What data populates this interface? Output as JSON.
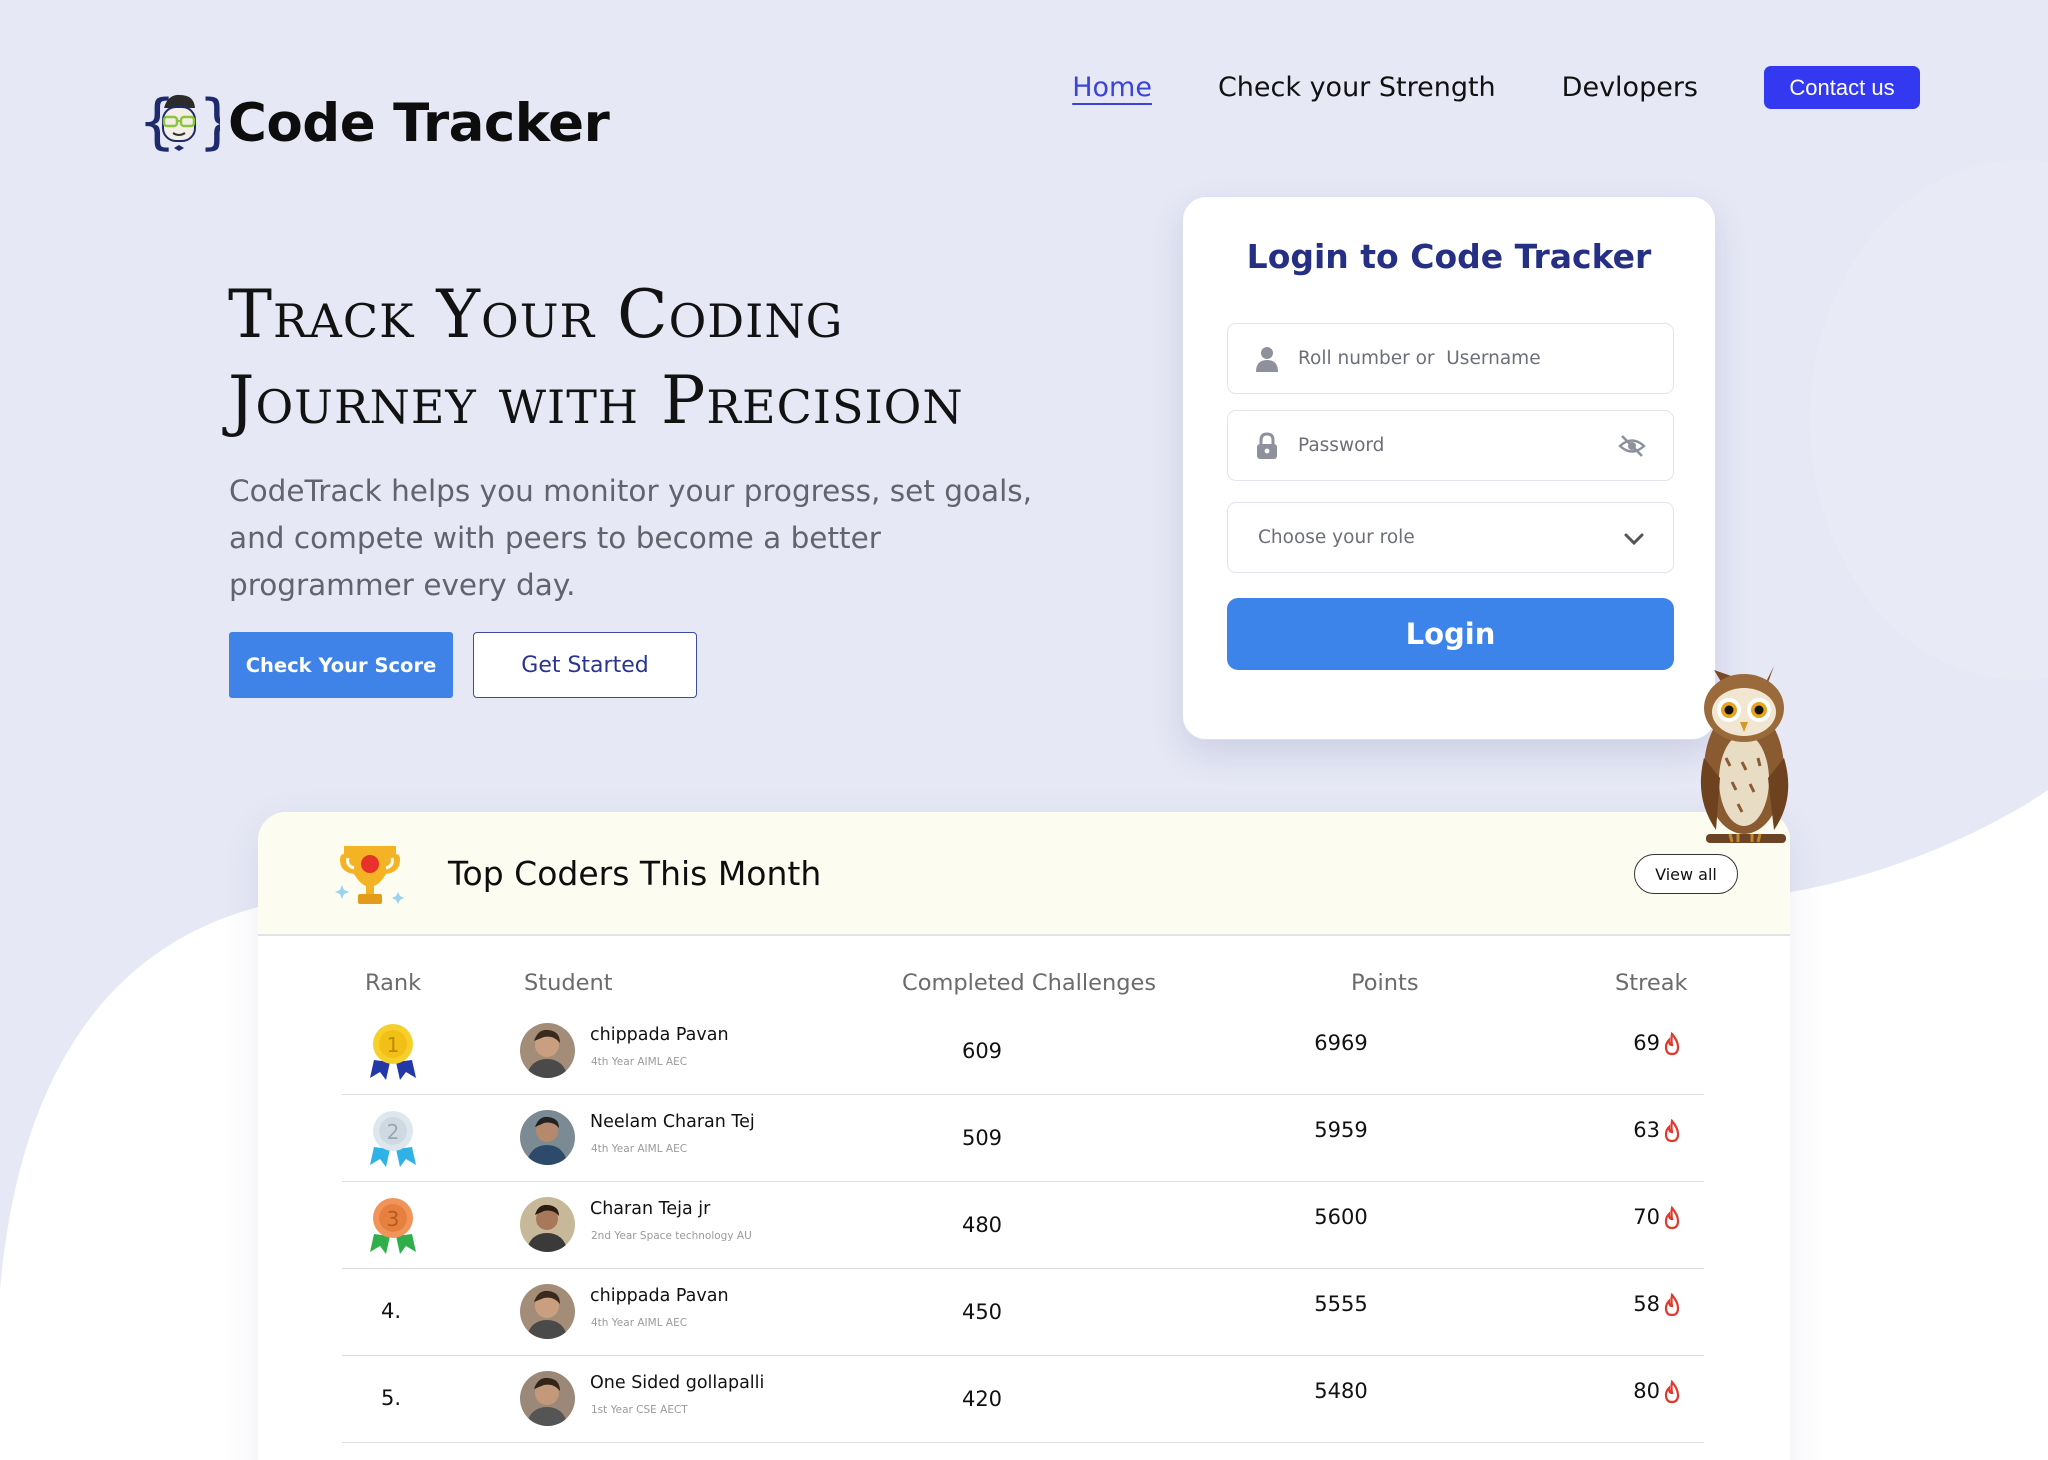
{
  "brand": {
    "name": "Code Tracker",
    "logo_icon": "coder-face-braces-icon"
  },
  "nav": {
    "items": [
      {
        "label": "Home",
        "active": true
      },
      {
        "label": "Check your Strength",
        "active": false
      },
      {
        "label": "Devlopers",
        "active": false
      }
    ],
    "contact_label": "Contact us"
  },
  "hero": {
    "title_line1": "Track Your Coding",
    "title_line2": "Journey with Precision",
    "description": "CodeTrack helps you monitor your progress, set goals, and compete with peers to become a better programmer every day.",
    "primary_button": "Check Your Score",
    "secondary_button": "Get Started"
  },
  "login": {
    "title": "Login to Code Tracker",
    "username_placeholder": "Roll number or  Username",
    "password_placeholder": "Password",
    "role_placeholder": "Choose your role",
    "submit_label": "Login"
  },
  "leaderboard": {
    "title": "Top Coders This Month",
    "view_all": "View all",
    "columns": {
      "rank": "Rank",
      "student": "Student",
      "challenges": "Completed Challenges",
      "points": "Points",
      "streak": "Streak"
    },
    "rows": [
      {
        "rank": "1",
        "medal": "gold",
        "name": "chippada Pavan",
        "sub": "4th Year AIML AEC",
        "challenges": "609",
        "points": "6969",
        "streak": "69"
      },
      {
        "rank": "2",
        "medal": "silver",
        "name": "Neelam Charan Tej",
        "sub": "4th Year AIML AEC",
        "challenges": "509",
        "points": "5959",
        "streak": "63"
      },
      {
        "rank": "3",
        "medal": "bronze",
        "name": "Charan Teja jr",
        "sub": "2nd Year Space technology  AU",
        "challenges": "480",
        "points": "5600",
        "streak": "70"
      },
      {
        "rank": "4.",
        "medal": "",
        "name": "chippada Pavan",
        "sub": "4th Year AIML AEC",
        "challenges": "450",
        "points": "5555",
        "streak": "58"
      },
      {
        "rank": "5.",
        "medal": "",
        "name": "One Sided gollapalli",
        "sub": "1st Year CSE AECT",
        "challenges": "420",
        "points": "5480",
        "streak": "80"
      }
    ]
  },
  "colors": {
    "background": "#e6e8f5",
    "accent": "#3339f0",
    "button_blue": "#3d84ea",
    "heading_navy": "#253085",
    "streak_flame": "#e03a2f"
  }
}
